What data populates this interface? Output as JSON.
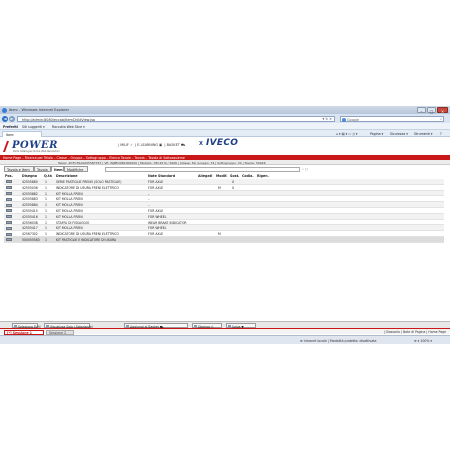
{
  "window": {
    "title": "Iberc - Windows Internet Explorer",
    "minimize": "–",
    "maximize": "□",
    "close": "×"
  },
  "address_bar": {
    "back": "◄",
    "forward": "►",
    "url": "http://admin:8080/eccab/ItemChildView.jsp",
    "controls": "▾ ↻ ✕",
    "search_placeholder": "Google",
    "search_icon": "⌕"
  },
  "favorites_bar": {
    "favorites": "Preferiti",
    "suggested": "Siti suggeriti ▾",
    "gallery": "Raccolta Web Slice ▾"
  },
  "tab": {
    "label": "Iberc"
  },
  "command_bar": {
    "icons": "⌂ ▾ ▤ ▾ ▭ ⎙ ▾",
    "page": "Pagina ▾",
    "safety": "Sicurezza ▾",
    "tools": "Strumenti ▾",
    "help": "?"
  },
  "app": {
    "logo_text": "POWER",
    "logo_subtitle": "Parts Catalogue Online Web Revolution",
    "top_links": [
      "| MILIF ✓",
      "| E-LEARNING ▣",
      "| BASKET ⛟"
    ],
    "brand_x": "X",
    "brand": "IVECO",
    "breadcrumb": "Home Page – Ricerca per Telaio – Classe – Gruppo – Sottogruppo – Elenco Tavole – Tavola – Tavola di Sottoassieme",
    "info_line": "Telaio: ZCFC35A0005587357 | VP: WJBE2981000000 | Modello: 35C15 N / 2006 | Classe: 50, Gruppo: 74 | Sottogruppo: 34 | Tavola: 50446"
  },
  "content_tabs": [
    {
      "label": "Tavola e Item"
    },
    {
      "label": "Tavola"
    },
    {
      "label": "Item"
    },
    {
      "label": "Modifiche"
    }
  ],
  "filter_icon": "⌕ ▢",
  "table": {
    "headers": [
      "Pos.",
      "Disegno",
      "Q.tà",
      "Descrizione",
      "Note Standard",
      "Allegati",
      "Modif.",
      "Sost.",
      "Codia.",
      "Rigen."
    ],
    "rows": [
      {
        "disegno": "42555880",
        "qta": "1",
        "desc": "SERIE PASTIGLIE FRENO (SOLO PASTIGLIE)",
        "note": "FOR AXLE",
        "modif": "",
        "sost": "X"
      },
      {
        "disegno": "42555036",
        "qta": "1",
        "desc": "INDICATORE DI USURA FRENI ELETTRICO",
        "note": "FOR AXLE",
        "modif": "M",
        "sost": "X"
      },
      {
        "disegno": "42555882",
        "qta": "1",
        "desc": "KIT MOLLA FRENI",
        "note": "–",
        "modif": "",
        "sost": ""
      },
      {
        "disegno": "42555883",
        "qta": "1",
        "desc": "KIT MOLLA FRENI",
        "note": "–",
        "modif": "",
        "sost": ""
      },
      {
        "disegno": "42555884",
        "qta": "1",
        "desc": "KIT MOLLA FRENI",
        "note": "–",
        "modif": "",
        "sost": ""
      },
      {
        "disegno": "42555415",
        "qta": "1",
        "desc": "KIT MOLLA FRENI",
        "note": "FOR AXLE",
        "modif": "",
        "sost": ""
      },
      {
        "disegno": "42555416",
        "qta": "1",
        "desc": "KIT MOLLA FRENI",
        "note": "FOR WHEEL",
        "modif": "",
        "sost": ""
      },
      {
        "disegno": "42556038",
        "qta": "1",
        "desc": "STAFFA DI FISSAGGIO",
        "note": "WEAR BRAKE INDICATOR",
        "modif": "",
        "sost": ""
      },
      {
        "disegno": "42555417",
        "qta": "1",
        "desc": "KIT MOLLA FRENI",
        "note": "FOR WHEEL",
        "modif": "",
        "sost": ""
      },
      {
        "disegno": "42567302",
        "qta": "1",
        "desc": "INDICATORE DI USURA FRENI ELETTRICO",
        "note": "FOR AXLE",
        "modif": "M",
        "sost": ""
      },
      {
        "disegno": "500055583",
        "qta": "1",
        "desc": "KIT PASTIGLIE E INDICATORE DI USURA",
        "note": "",
        "modif": "",
        "sost": ""
      }
    ]
  },
  "bottom_buttons": {
    "select_all": "Seleziona Tutti",
    "view_selected": "Visualizza Solo i Selezionati",
    "add_basket": "Aggiungi al Basket ⛟",
    "print": "Stampa ⎙",
    "save": "Salva ▼"
  },
  "sessions": {
    "s1": "[*] Sessione 1",
    "s2": "Sessione 2",
    "right": "| Glossario | Note di Pagina | Home Page"
  },
  "status_bar": {
    "zone": "⊕ Intranet locale | Modalità protetta: disattivata",
    "zoom": "⊕ ▾ 100% ▾"
  }
}
